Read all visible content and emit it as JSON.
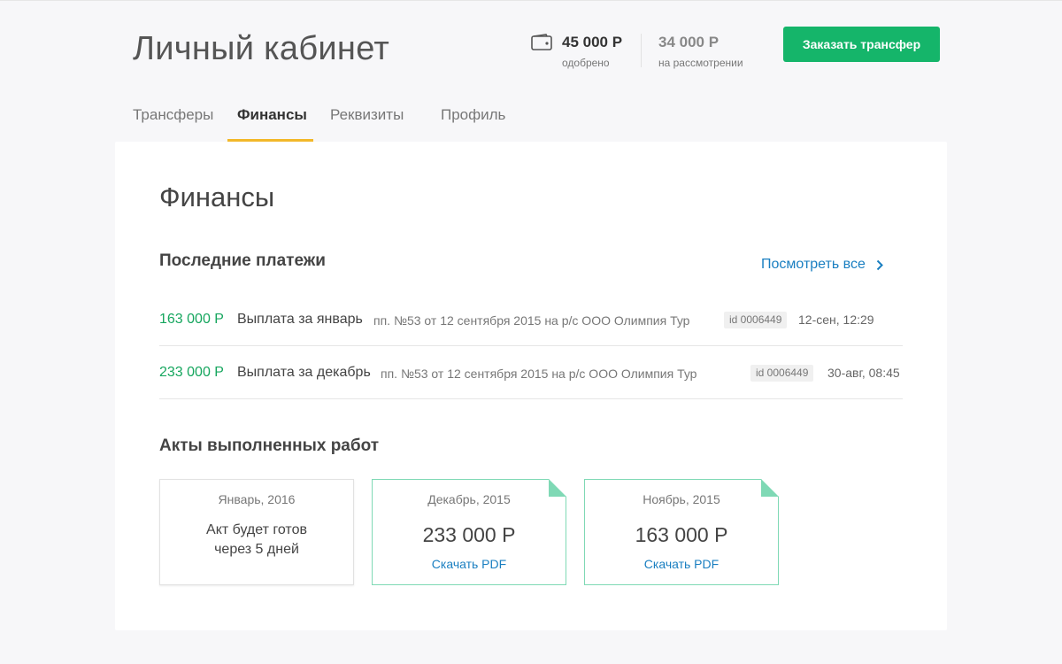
{
  "header": {
    "title": "Личный кабинет",
    "approved_amount": "45 000 Р",
    "approved_label": "одобрено",
    "review_amount": "34 000 Р",
    "review_label": "на рассмотрении",
    "order_button": "Заказать трансфер",
    "wallet_icon": "wallet-icon"
  },
  "tabs": [
    {
      "label": "Трансферы",
      "active": false
    },
    {
      "label": "Финансы",
      "active": true
    },
    {
      "label": "Реквизиты",
      "active": false
    },
    {
      "label": "Профиль",
      "active": false
    }
  ],
  "main": {
    "title": "Финансы",
    "payments_title": "Последние платежи",
    "view_all": "Посмотреть все",
    "payments": [
      {
        "amount": "163 000 Р",
        "title": "Выплата за январь",
        "detail": "пп. №53 от 12 сентября 2015  на р/с ООО Олимпия Тур",
        "id": "id 0006449",
        "date": "12-сен, 12:29"
      },
      {
        "amount": "233 000 Р",
        "title": "Выплата за декабрь",
        "detail": "пп. №53 от 12 сентября 2015  на р/с ООО Олимпия Тур",
        "id": "id 0006449",
        "date": "30-авг, 08:45"
      }
    ],
    "acts_title": "Акты выполненных работ",
    "acts": [
      {
        "period": "Январь, 2016",
        "note_line1": "Акт будет готов",
        "note_line2": "через 5 дней"
      },
      {
        "period": "Декабрь, 2015",
        "amount": "233 000 Р",
        "link": "Скачать PDF"
      },
      {
        "period": "Ноябрь, 2015",
        "amount": "163 000 Р",
        "link": "Скачать PDF"
      }
    ]
  },
  "colors": {
    "accent_green": "#15b56a",
    "amount_green": "#16a65e",
    "link_blue": "#1a7fc1",
    "tab_underline": "#f2b829",
    "act_border": "#7fd9b5"
  }
}
